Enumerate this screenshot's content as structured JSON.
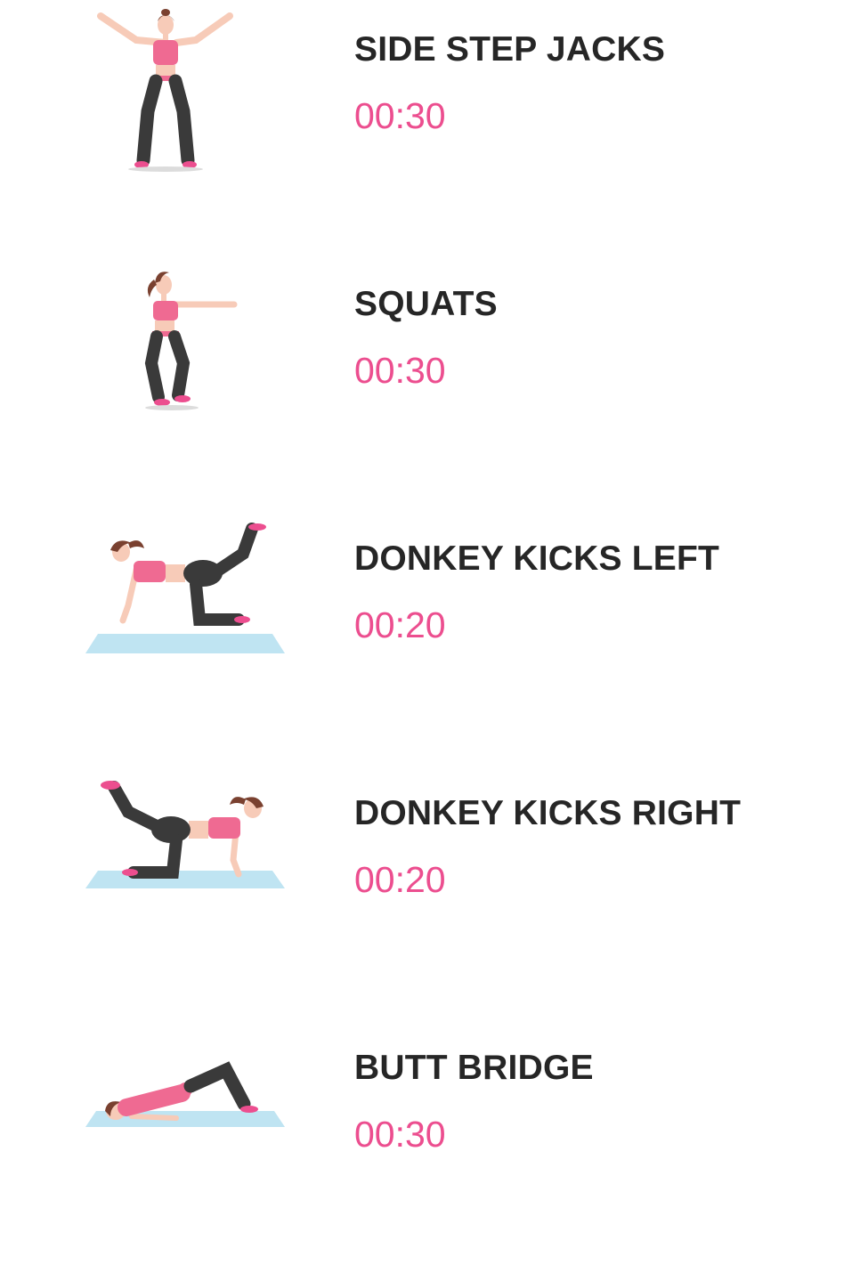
{
  "exercises": [
    {
      "name": "SIDE STEP JACKS",
      "duration": "00:30",
      "illustration": "side-step-jacks-figure-icon"
    },
    {
      "name": "SQUATS",
      "duration": "00:30",
      "illustration": "squats-figure-icon"
    },
    {
      "name": "DONKEY KICKS LEFT",
      "duration": "00:20",
      "illustration": "donkey-kicks-left-figure-icon"
    },
    {
      "name": "DONKEY KICKS RIGHT",
      "duration": "00:20",
      "illustration": "donkey-kicks-right-figure-icon"
    },
    {
      "name": "BUTT BRIDGE",
      "duration": "00:30",
      "illustration": "butt-bridge-figure-icon"
    }
  ],
  "colors": {
    "accent": "#ec4e8f",
    "title_text": "#262626",
    "outfit_pink": "#ef6a92",
    "leggings": "#3a3a3a",
    "skin": "#f7cbb8",
    "hair": "#7a4130",
    "mat": "#bfe4f2"
  }
}
